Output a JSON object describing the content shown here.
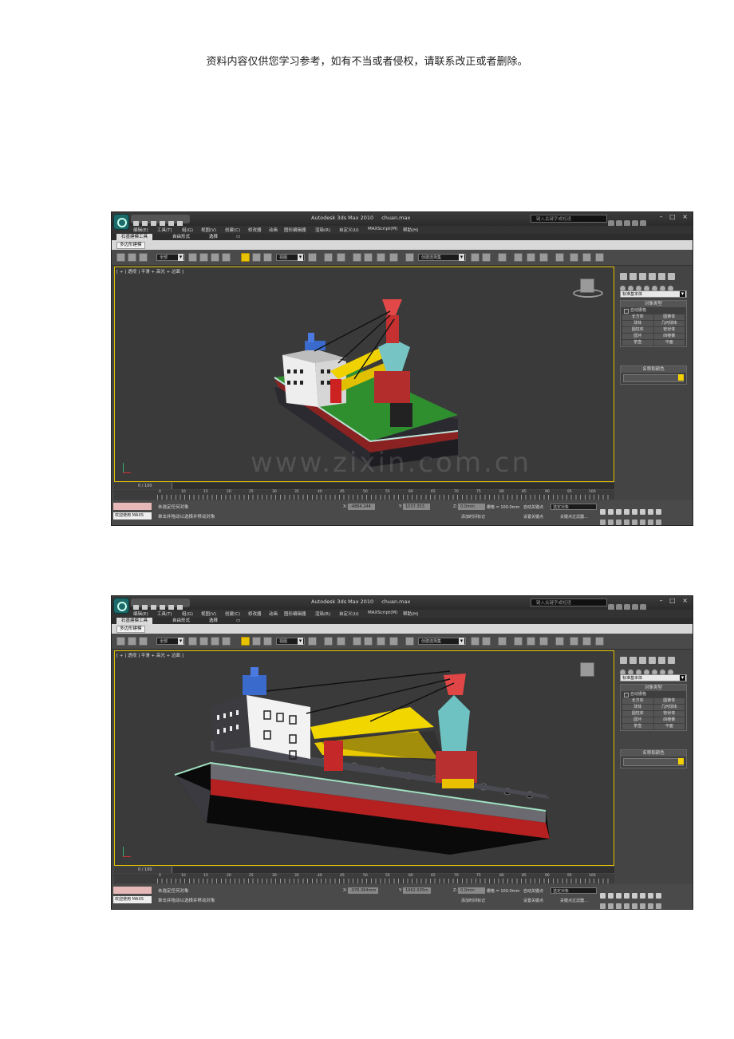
{
  "disclaimer": "资料内容仅供您学习参考，如有不当或者侵权，请联系改正或者删除。",
  "app": {
    "title": "Autodesk 3ds Max 2010",
    "filename": "chuan.max",
    "search_placeholder": "键入关键字或短语",
    "window_buttons": "– □ ×"
  },
  "menu": [
    "编辑(E)",
    "工具(T)",
    "组(G)",
    "视图(V)",
    "创建(C)",
    "修改器",
    "动画",
    "图形编辑器",
    "渲染(R)",
    "自定义(U)",
    "MAXScript(M)",
    "帮助(H)"
  ],
  "ribbon_tabs": [
    "石墨建模工具",
    "自由形式",
    "选择"
  ],
  "ribbon_panel": "多边形建模",
  "toolbar": {
    "selection_filter": "全部",
    "ref_coord": "视图",
    "named_selection": "创建选择集"
  },
  "viewport_label": "[ + ] 透视 ] 平滑 + 高光 + 边面 ]",
  "command_panel": {
    "category": "标准基本体",
    "object_type_title": "对象类型",
    "autogrid": "自动栅格",
    "primitives": [
      "长方体",
      "圆锥体",
      "球体",
      "几何球体",
      "圆柱体",
      "管状体",
      "圆环",
      "四棱锥",
      "茶壶",
      "平面"
    ],
    "name_color_title": "名称和颜色"
  },
  "timeslider": "0 / 100",
  "ruler_labels": [
    "0",
    "10",
    "15",
    "20",
    "25",
    "30",
    "35",
    "40",
    "45",
    "50",
    "55",
    "60",
    "65",
    "70",
    "75",
    "80",
    "85",
    "90",
    "95",
    "100"
  ],
  "status": {
    "welcome": "欢迎使用 MAXS",
    "line1": "未选定任何对象",
    "line2": "单击并拖动以选择并移动对象",
    "grid": "栅格 = 100.0mm",
    "add_time_tag": "添加时间标记",
    "auto_key": "自动关键点",
    "set_key": "设置关键点",
    "selected_object": "选定对象",
    "key_filters": "关键点过滤器..."
  },
  "screens": [
    {
      "x": "-4864.244",
      "y": "1037.353",
      "z": "0.0mm"
    },
    {
      "x": "-976.364mm",
      "y": "1962.035m",
      "z": "0.0mm"
    }
  ],
  "watermark": "www.zixin.com.cn"
}
